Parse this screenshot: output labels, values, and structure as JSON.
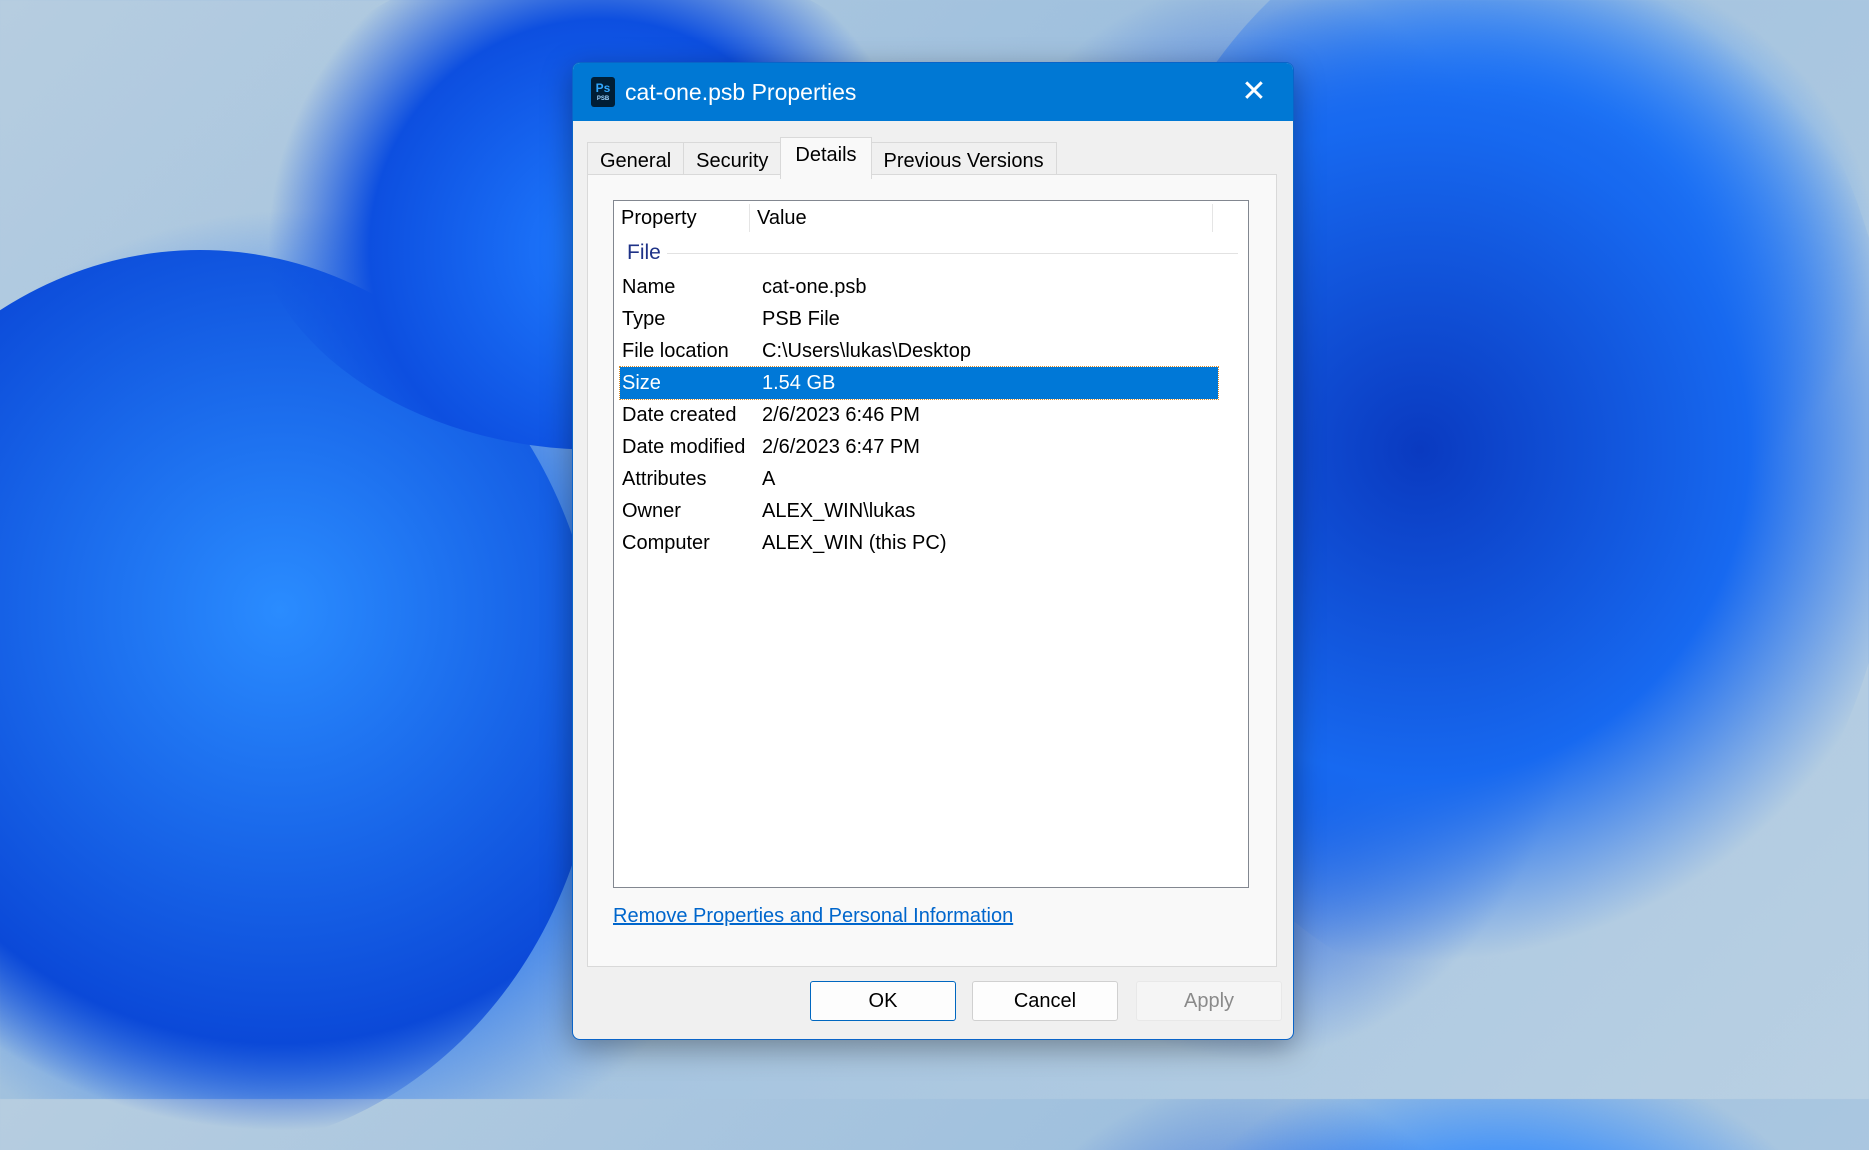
{
  "window": {
    "title": "cat-one.psb Properties",
    "app_icon_text": "Ps",
    "app_icon_subtext": "PSB",
    "close_glyph": "✕"
  },
  "tabs": [
    {
      "label": "General",
      "active": false
    },
    {
      "label": "Security",
      "active": false
    },
    {
      "label": "Details",
      "active": true
    },
    {
      "label": "Previous Versions",
      "active": false
    }
  ],
  "details": {
    "columns": [
      "Property",
      "Value"
    ],
    "group": "File",
    "rows": [
      {
        "property": "Name",
        "value": "cat-one.psb",
        "selected": false
      },
      {
        "property": "Type",
        "value": "PSB File",
        "selected": false
      },
      {
        "property": "File location",
        "value": "C:\\Users\\lukas\\Desktop",
        "selected": false
      },
      {
        "property": "Size",
        "value": "1.54 GB",
        "selected": true
      },
      {
        "property": "Date created",
        "value": "2/6/2023 6:46 PM",
        "selected": false
      },
      {
        "property": "Date modified",
        "value": "2/6/2023 6:47 PM",
        "selected": false
      },
      {
        "property": "Attributes",
        "value": "A",
        "selected": false
      },
      {
        "property": "Owner",
        "value": "ALEX_WIN\\lukas",
        "selected": false
      },
      {
        "property": "Computer",
        "value": "ALEX_WIN (this PC)",
        "selected": false
      }
    ]
  },
  "link": {
    "label": "Remove Properties and Personal Information"
  },
  "buttons": {
    "ok": "OK",
    "cancel": "Cancel",
    "apply": "Apply"
  },
  "colors": {
    "accent": "#0078d4",
    "selection": "#0078d7",
    "link": "#0066cc",
    "group": "#1e3287"
  }
}
